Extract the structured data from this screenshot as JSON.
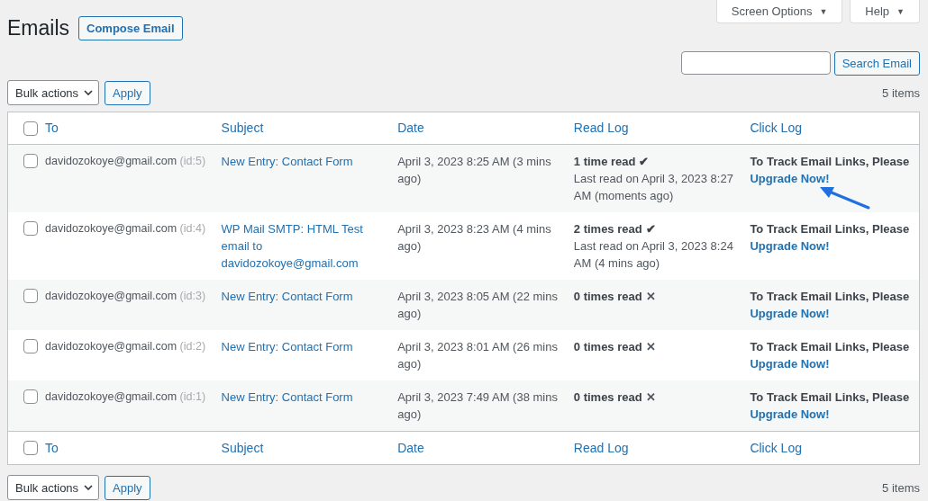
{
  "header_buttons": [
    {
      "label": "Screen Options",
      "caret": "▼"
    },
    {
      "label": "Help",
      "caret": "▼"
    }
  ],
  "title": "Emails",
  "compose_button": "Compose Email",
  "search": {
    "button": "Search Email"
  },
  "top_nav": {
    "bulk_actions": "Bulk actions",
    "apply": "Apply",
    "count": "5 items"
  },
  "table": {
    "columns": [
      "To",
      "Subject",
      "Date",
      "Read Log",
      "Click Log"
    ],
    "select_all_checked": false,
    "rows": [
      {
        "checked": false,
        "to": "davidozokoye@gmail.com",
        "id": "(id:5)",
        "subject": "New Entry: Contact Form",
        "date": "April 3, 2023 8:25 AM (3 mins ago)",
        "read": {
          "opened": true,
          "summary": "1 time read",
          "mark": "✔",
          "detail": "Last read on April 3, 2023 8:27 AM  (moments ago)"
        },
        "click_text": "To Track Email Links, Please",
        "click_link": "Upgrade Now!",
        "pointer_arrow": true
      },
      {
        "checked": false,
        "to": "davidozokoye@gmail.com",
        "id": "(id:4)",
        "subject": "WP Mail SMTP: HTML Test email to davidozokoye@gmail.com",
        "date": "April 3, 2023 8:23 AM (4 mins ago)",
        "read": {
          "opened": true,
          "summary": "2 times read",
          "mark": "✔",
          "detail": "Last read on April 3, 2023 8:24 AM  (4 mins ago)"
        },
        "click_text": "To Track Email Links, Please",
        "click_link": "Upgrade Now!",
        "pointer_arrow": false
      },
      {
        "checked": false,
        "to": "davidozokoye@gmail.com",
        "id": "(id:3)",
        "subject": "New Entry: Contact Form",
        "date": "April 3, 2023 8:05 AM (22 mins ago)",
        "read": {
          "opened": false,
          "summary": "0 times read",
          "mark": "✕"
        },
        "click_text": "To Track Email Links, Please",
        "click_link": "Upgrade Now!",
        "pointer_arrow": false
      },
      {
        "checked": false,
        "to": "davidozokoye@gmail.com",
        "id": "(id:2)",
        "subject": "New Entry: Contact Form",
        "date": "April 3, 2023 8:01 AM (26 mins ago)",
        "read": {
          "opened": false,
          "summary": "0 times read",
          "mark": "✕"
        },
        "click_text": "To Track Email Links, Please",
        "click_link": "Upgrade Now!",
        "pointer_arrow": false
      },
      {
        "checked": false,
        "to": "davidozokoye@gmail.com",
        "id": "(id:1)",
        "subject": "New Entry: Contact Form",
        "date": "April 3, 2023 7:49 AM (38 mins ago)",
        "read": {
          "opened": false,
          "summary": "0 times read",
          "mark": "✕"
        },
        "click_text": "To Track Email Links, Please",
        "click_link": "Upgrade Now!",
        "pointer_arrow": false
      }
    ],
    "footer_columns": [
      "To",
      "Subject",
      "Date",
      "Read Log",
      "Click Log"
    ],
    "footer_select_all_checked": false
  },
  "bottom_nav": {
    "bulk_actions": "Bulk actions",
    "apply": "Apply",
    "count": "5 items"
  }
}
